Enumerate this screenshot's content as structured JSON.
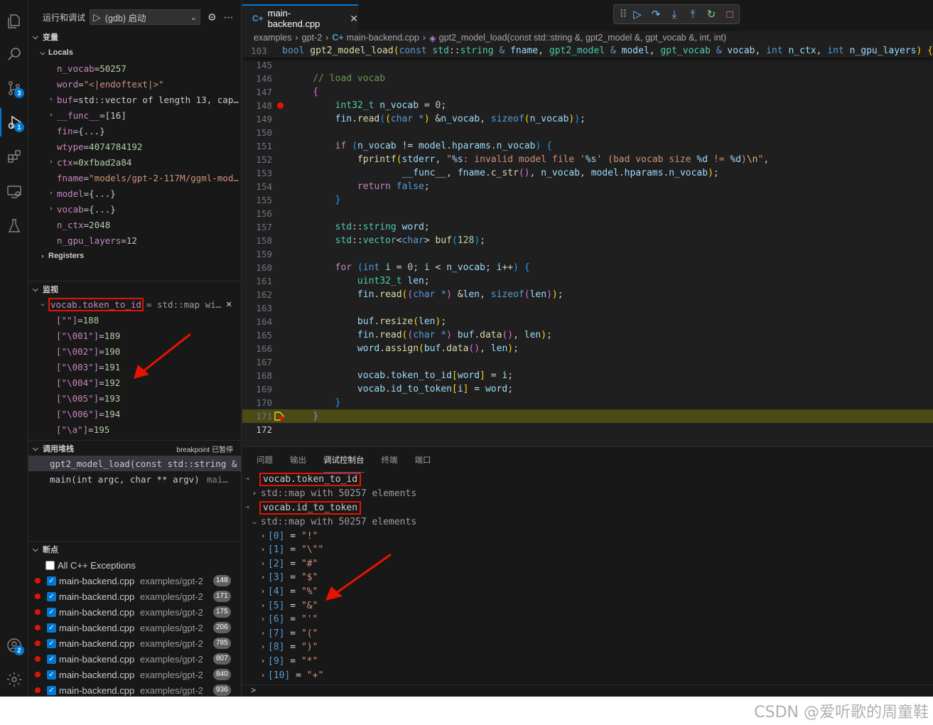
{
  "activity": {
    "icons": [
      "files-icon",
      "search-icon",
      "source-control-icon",
      "run-debug-icon",
      "extensions-icon",
      "remote-explorer-icon",
      "testing-icon",
      "accounts-icon",
      "settings-gear-icon"
    ],
    "scm_badge": "3",
    "debug_badge": "1",
    "accounts_badge": "2"
  },
  "sidebar": {
    "run_title": "运行和调试",
    "config": "(gdb) 启动",
    "variables_title": "变量",
    "locals_title": "Locals",
    "locals": [
      {
        "name": "n_vocab",
        "value": "50257",
        "kind": "num",
        "expandable": false
      },
      {
        "name": "word",
        "value": "\"<|endoftext|>\"",
        "kind": "str",
        "expandable": false
      },
      {
        "name": "buf",
        "value": "std::vector of length 13, cap…",
        "kind": "obj",
        "expandable": true
      },
      {
        "name": "__func__",
        "value": "[16]",
        "kind": "obj",
        "expandable": true
      },
      {
        "name": "fin",
        "value": "{...}",
        "kind": "obj",
        "expandable": false
      },
      {
        "name": "wtype",
        "value": "4074784192",
        "kind": "num",
        "expandable": false
      },
      {
        "name": "ctx",
        "value": "0xfbad2a84",
        "kind": "num",
        "expandable": true
      },
      {
        "name": "fname",
        "value": "\"models/gpt-2-117M/ggml-mod…",
        "kind": "str",
        "expandable": false
      },
      {
        "name": "model",
        "value": "{...}",
        "kind": "obj",
        "expandable": true
      },
      {
        "name": "vocab",
        "value": "{...}",
        "kind": "obj",
        "expandable": true
      },
      {
        "name": "n_ctx",
        "value": "2048",
        "kind": "num",
        "expandable": false
      },
      {
        "name": "n_gpu_layers",
        "value": "12",
        "kind": "num",
        "expandable": false
      }
    ],
    "registers_title": "Registers",
    "watch_title": "监视",
    "watch_expr": "vocab.token_to_id",
    "watch_value": "= std::map with…",
    "watch_items": [
      {
        "key": "[\"\"]",
        "value": "188"
      },
      {
        "key": "[\"\\001\"]",
        "value": "189"
      },
      {
        "key": "[\"\\002\"]",
        "value": "190"
      },
      {
        "key": "[\"\\003\"]",
        "value": "191"
      },
      {
        "key": "[\"\\004\"]",
        "value": "192"
      },
      {
        "key": "[\"\\005\"]",
        "value": "193"
      },
      {
        "key": "[\"\\006\"]",
        "value": "194"
      },
      {
        "key": "[\"\\a\"]",
        "value": "195"
      }
    ],
    "callstack_title": "调用堆栈",
    "callstack_status": "breakpoint 已暂停",
    "callstack": [
      {
        "frame": "gpt2_model_load(const std::string & fr",
        "file": ""
      },
      {
        "frame": "main(int argc, char ** argv)",
        "file": "mai…"
      }
    ],
    "breakpoints_title": "断点",
    "exceptions_label": "All C++ Exceptions",
    "breakpoints": [
      {
        "file": "main-backend.cpp",
        "path": "examples/gpt-2",
        "line": "148"
      },
      {
        "file": "main-backend.cpp",
        "path": "examples/gpt-2",
        "line": "171"
      },
      {
        "file": "main-backend.cpp",
        "path": "examples/gpt-2",
        "line": "175"
      },
      {
        "file": "main-backend.cpp",
        "path": "examples/gpt-2",
        "line": "206"
      },
      {
        "file": "main-backend.cpp",
        "path": "examples/gpt-2",
        "line": "785"
      },
      {
        "file": "main-backend.cpp",
        "path": "examples/gpt-2",
        "line": "807"
      },
      {
        "file": "main-backend.cpp",
        "path": "examples/gpt-2",
        "line": "840"
      },
      {
        "file": "main-backend.cpp",
        "path": "examples/gpt-2",
        "line": "936"
      }
    ]
  },
  "editor": {
    "tab_label": "main-backend.cpp",
    "breadcrumb": [
      "examples",
      "gpt-2",
      "main-backend.cpp",
      "gpt2_model_load(const std::string &, gpt2_model &, gpt_vocab &, int, int)"
    ],
    "sticky_line_number": "103",
    "line_numbers": [
      "145",
      "146",
      "147",
      "148",
      "149",
      "150",
      "151",
      "152",
      "153",
      "154",
      "155",
      "156",
      "157",
      "158",
      "159",
      "160",
      "161",
      "162",
      "163",
      "164",
      "165",
      "166",
      "167",
      "168",
      "169",
      "170",
      "171",
      "172"
    ],
    "breakpoint_line": "148",
    "current_line": "171"
  },
  "panel": {
    "tabs": [
      "问题",
      "输出",
      "调试控制台",
      "终端",
      "端口"
    ],
    "active_tab": "调试控制台",
    "expr1": "vocab.token_to_id",
    "result1": "std::map with 50257 elements",
    "expr2": "vocab.id_to_token",
    "result2": "std::map with 50257 elements",
    "entries": [
      {
        "idx": "[0]",
        "val": "\"!\""
      },
      {
        "idx": "[1]",
        "val": "\"\\\"\""
      },
      {
        "idx": "[2]",
        "val": "\"#\""
      },
      {
        "idx": "[3]",
        "val": "\"$\""
      },
      {
        "idx": "[4]",
        "val": "\"%\""
      },
      {
        "idx": "[5]",
        "val": "\"&\""
      },
      {
        "idx": "[6]",
        "val": "\"'\""
      },
      {
        "idx": "[7]",
        "val": "\"(\""
      },
      {
        "idx": "[8]",
        "val": "\")\""
      },
      {
        "idx": "[9]",
        "val": "\"*\""
      },
      {
        "idx": "[10]",
        "val": "\"+\""
      }
    ],
    "prompt": ">"
  },
  "watermark": "CSDN @爱听歌的周童鞋",
  "colors": {
    "accent": "#0078d4",
    "highlight_box": "#e51400",
    "current_line_bg": "#4b4b18",
    "breakpoint": "#e51400"
  }
}
